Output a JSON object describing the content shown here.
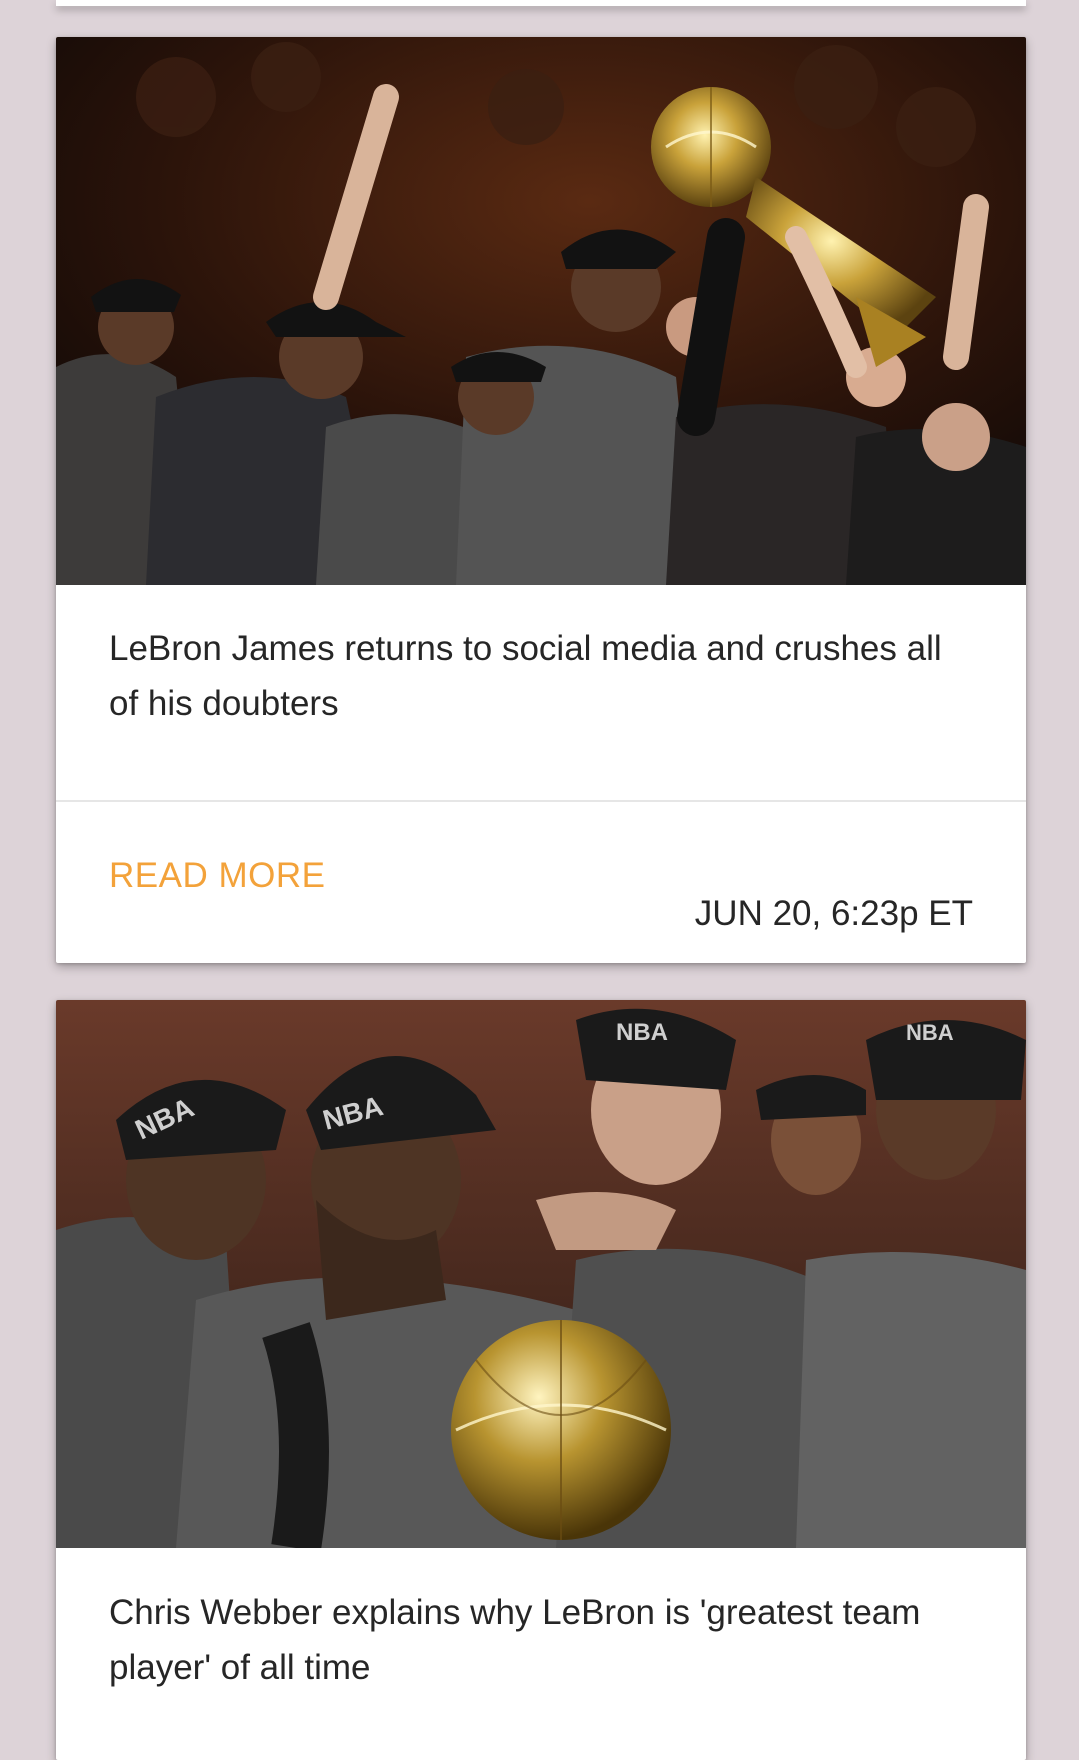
{
  "articles": [
    {
      "title": "LeBron James returns to social media and crushes all of his doubters",
      "image_label": "Photo: LeBron James raising the Larry O'Brien trophy amid teammates in NBA Champs caps",
      "read_more_label": "READ MORE",
      "timestamp": "JUN 20, 6:23p ET"
    },
    {
      "title": "Chris Webber explains why LeBron is 'greatest team player' of all time",
      "image_label": "Photo: Emotional LeBron James in NBA Champs cap with trophy, teammates around him"
    }
  ],
  "colors": {
    "page_background": "#ddd3d8",
    "card_background": "#ffffff",
    "accent": "#f3a23a",
    "text": "#262626",
    "divider": "#e6e6e6"
  }
}
